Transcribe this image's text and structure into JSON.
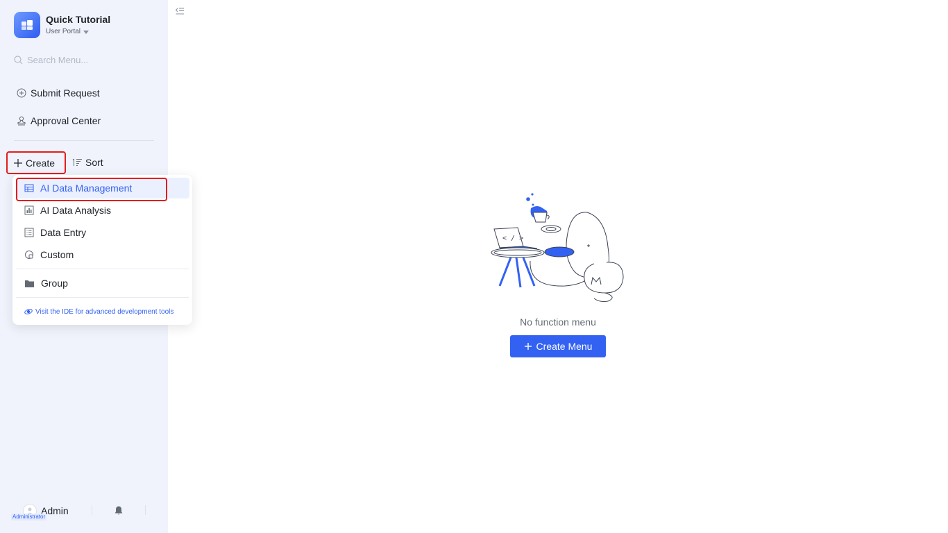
{
  "app": {
    "title": "Quick Tutorial",
    "portal": "User Portal"
  },
  "search": {
    "placeholder": "Search Menu..."
  },
  "nav": {
    "submit_request": "Submit Request",
    "approval_center": "Approval Center"
  },
  "toolbar": {
    "create_label": "Create",
    "sort_label": "Sort"
  },
  "dropdown": {
    "items": [
      {
        "label": "AI Data Management",
        "icon": "table-icon",
        "active": true
      },
      {
        "label": "AI Data Analysis",
        "icon": "bar-chart-icon",
        "active": false
      },
      {
        "label": "Data Entry",
        "icon": "form-icon",
        "active": false
      },
      {
        "label": "Custom",
        "icon": "custom-page-icon",
        "active": false
      }
    ],
    "group_label": "Group",
    "footer_link": "Visit the IDE for advanced development tools"
  },
  "user": {
    "name": "Admin",
    "role": "Administrator"
  },
  "main": {
    "empty_text": "No function menu",
    "create_menu_label": "Create Menu"
  },
  "colors": {
    "accent": "#3362f2",
    "sidebar_bg": "#f0f3fc",
    "highlight_border": "#e51c1c"
  }
}
